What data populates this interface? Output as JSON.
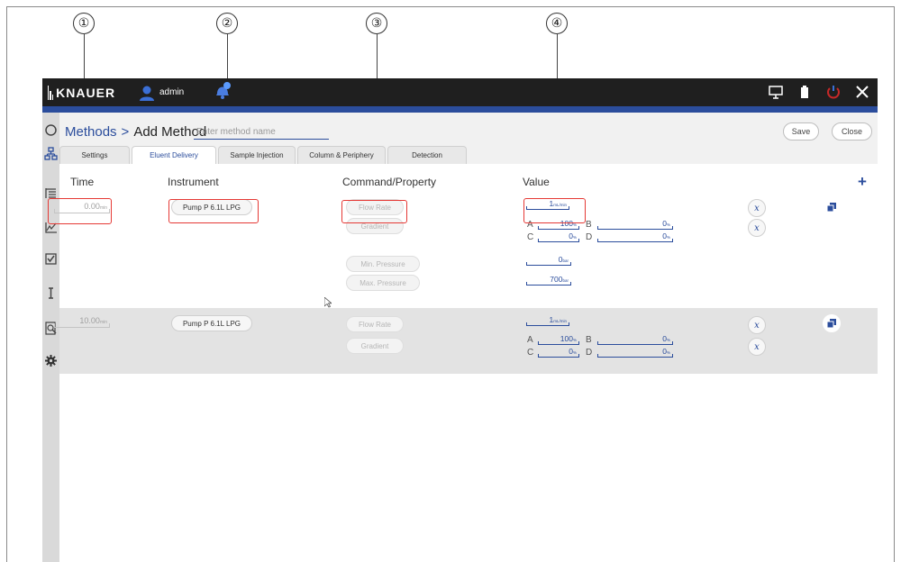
{
  "callouts": [
    "①",
    "②",
    "③",
    "④"
  ],
  "topbar": {
    "logo_text": "KNAUER",
    "user": "admin",
    "icons": [
      "user-icon",
      "notification-bell-icon",
      "monitor-icon",
      "battery-icon",
      "power-icon",
      "close-icon"
    ]
  },
  "sidebar": {
    "icons": [
      "status-circle-icon",
      "hierarchy-icon",
      "sequence-list-icon",
      "chart-icon",
      "checkbox-icon",
      "text-cursor-icon",
      "search-document-icon",
      "settings-gear-icon"
    ]
  },
  "header": {
    "breadcrumb_root": "Methods",
    "breadcrumb_sep": ">",
    "breadcrumb_current": "Add Method",
    "name_placeholder": "Enter method name",
    "save_label": "Save",
    "close_label": "Close"
  },
  "tabs": [
    {
      "label": "Settings",
      "active": false
    },
    {
      "label": "Eluent Delivery",
      "active": true
    },
    {
      "label": "Sample Injection",
      "active": false
    },
    {
      "label": "Column & Periphery",
      "active": false
    },
    {
      "label": "Detection",
      "active": false
    }
  ],
  "columns": {
    "time": "Time",
    "instrument": "Instrument",
    "command": "Command/Property",
    "value": "Value"
  },
  "rows": [
    {
      "time": "0.00",
      "time_unit": "min",
      "instrument": "Pump P 6.1L LPG",
      "commands": [
        "Flow Rate",
        "Gradient",
        "Min. Pressure",
        "Max. Pressure"
      ],
      "flow": "1",
      "flow_unit": "mL/min",
      "gradient": {
        "A": "100",
        "B": "0",
        "C": "0",
        "D": "0",
        "unit": "%"
      },
      "min_pressure": "0",
      "max_pressure": "700",
      "pressure_unit": "bar"
    },
    {
      "time": "10.00",
      "time_unit": "min",
      "instrument": "Pump P 6.1L LPG",
      "commands": [
        "Flow Rate",
        "Gradient"
      ],
      "flow": "1",
      "flow_unit": "mL/min",
      "gradient": {
        "A": "100",
        "B": "0",
        "C": "0",
        "D": "0",
        "unit": "%"
      }
    }
  ],
  "labels": {
    "A": "A",
    "B": "B",
    "C": "C",
    "D": "D",
    "x": "x"
  },
  "colors": {
    "accent": "#2b4d9c",
    "highlight": "#e53935",
    "topbar": "#1f1f1f"
  }
}
